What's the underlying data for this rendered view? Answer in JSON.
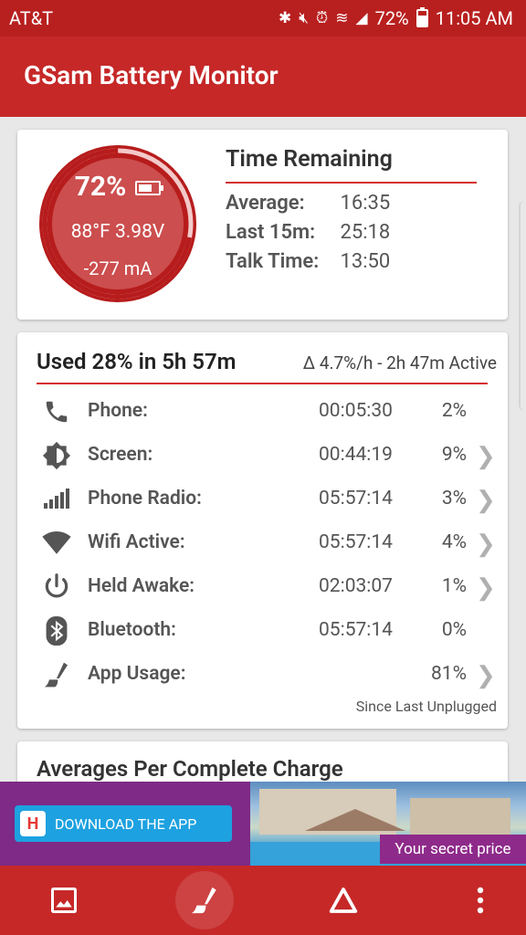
{
  "status_bar": {
    "carrier": "AT&T",
    "battery_pct": "72%",
    "time": "11:05 AM"
  },
  "app": {
    "title": "GSam Battery Monitor"
  },
  "battery_card": {
    "percent": "72%",
    "temp_voltage": "88°F  3.98V",
    "current": "-277 mA",
    "charge_level": 0.72,
    "time_remaining": {
      "title": "Time Remaining",
      "rows": [
        {
          "label": "Average:",
          "value": "16:35"
        },
        {
          "label": "Last 15m:",
          "value": "25:18"
        },
        {
          "label": "Talk Time:",
          "value": "13:50"
        }
      ]
    }
  },
  "usage_card": {
    "title": "Used 28% in 5h 57m",
    "rate": "Δ 4.7%/h - 2h 47m Active",
    "rows": [
      {
        "label": "Phone:",
        "time": "00:05:30",
        "pct": "2%",
        "chevron": false,
        "icon": "phone-icon"
      },
      {
        "label": "Screen:",
        "time": "00:44:19",
        "pct": "9%",
        "chevron": true,
        "icon": "brightness-icon"
      },
      {
        "label": "Phone Radio:",
        "time": "05:57:14",
        "pct": "3%",
        "chevron": true,
        "icon": "signal-bars-icon"
      },
      {
        "label": "Wifi Active:",
        "time": "05:57:14",
        "pct": "4%",
        "chevron": true,
        "icon": "wifi-icon"
      },
      {
        "label": "Held Awake:",
        "time": "02:03:07",
        "pct": "1%",
        "chevron": true,
        "icon": "power-icon"
      },
      {
        "label": "Bluetooth:",
        "time": "05:57:14",
        "pct": "0%",
        "chevron": false,
        "icon": "bluetooth-icon"
      },
      {
        "label": "App Usage:",
        "time": "",
        "pct": "81%",
        "chevron": true,
        "icon": "app-usage-icon"
      }
    ],
    "since": "Since Last Unplugged"
  },
  "averages_card": {
    "title": "Averages Per Complete Charge"
  },
  "ad": {
    "download_label": "DOWNLOAD THE APP",
    "secret_price": "Your secret price"
  },
  "colors": {
    "primary": "#c62828",
    "accent": "#d32f2f"
  }
}
